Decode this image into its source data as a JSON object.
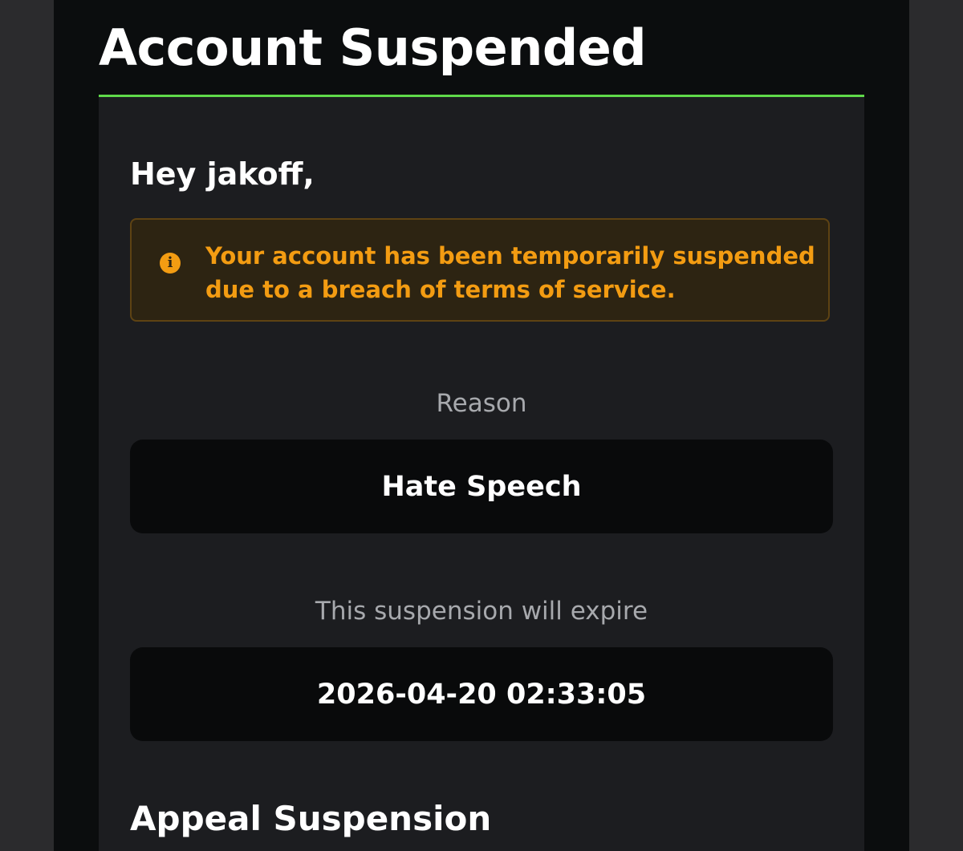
{
  "page_title": "Account Suspended",
  "greeting": "Hey jakoff,",
  "alert": {
    "icon": "info-icon",
    "icon_glyph": "i",
    "message": "Your account has been temporarily suspended due to a breach of terms of service."
  },
  "reason": {
    "label": "Reason",
    "value": "Hate Speech"
  },
  "expiry": {
    "label": "This suspension will expire",
    "value": "2026-04-20 02:33:05"
  },
  "appeal": {
    "heading": "Appeal Suspension"
  },
  "colors": {
    "accent": "#5fd94a",
    "warning_text": "#f39c12",
    "warning_background": "#2d2412",
    "card_background": "#1c1d20",
    "page_background": "#0b0d0e"
  }
}
